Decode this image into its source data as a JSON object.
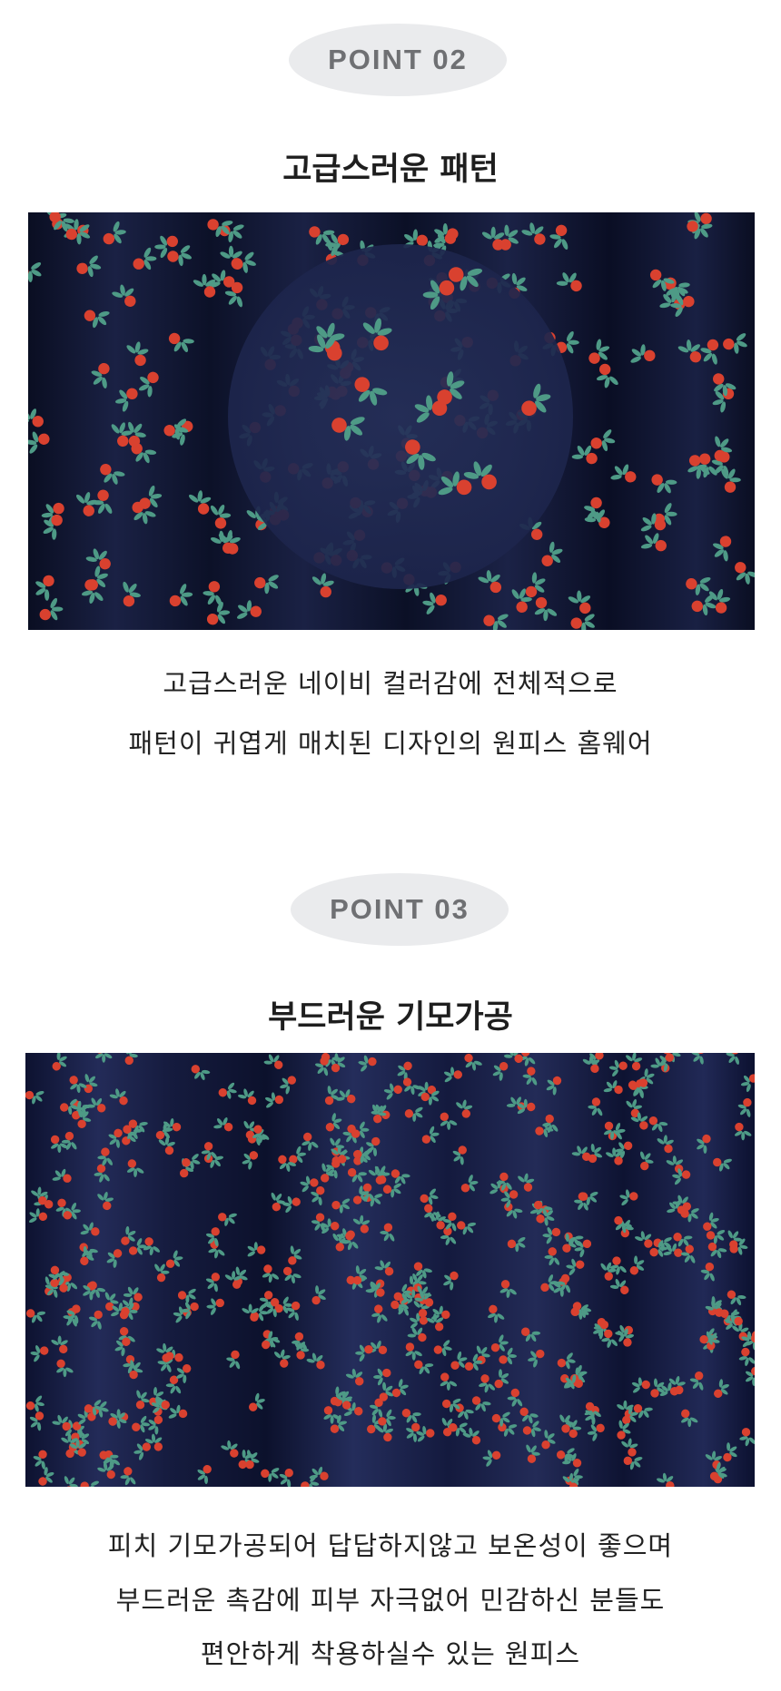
{
  "point02": {
    "badge": "POINT 02",
    "title": "고급스러운 패턴",
    "image": {
      "kind": "fabric-photo",
      "subject": "navy cherry print fabric with magnified circle"
    },
    "desc_lines": [
      "고급스러운 네이비 컬러감에 전체적으로",
      "패턴이 귀엽게 매치된 디자인의 원피스 홈웨어"
    ]
  },
  "point03": {
    "badge": "POINT 03",
    "title": "부드러운 기모가공",
    "image": {
      "kind": "fabric-photo",
      "subject": "draped navy cherry print fabric"
    },
    "desc_lines": [
      "피치 기모가공되어 답답하지않고 보온성이 좋으며",
      "부드러운 촉감에 피부 자극없어 민감하신 분들도",
      "편안하게 착용하실수 있는 원피스"
    ]
  },
  "colors": {
    "badge_bg": "#eaebed",
    "badge_text": "#6f7073",
    "fabric_navy": "#141a35",
    "fabric_navy_light": "#222a4d",
    "cherry": "#d9412f",
    "leaf": "#4e9a86"
  }
}
